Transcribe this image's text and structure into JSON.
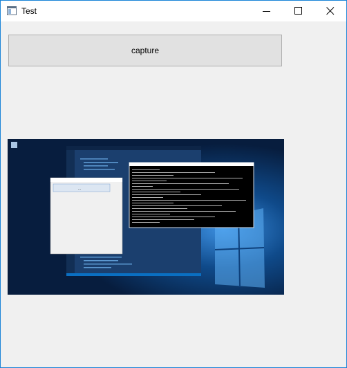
{
  "window": {
    "title": "Test"
  },
  "titlebar": {
    "icons": [
      "app-icon",
      "minimize-icon",
      "maximize-icon",
      "close-icon"
    ]
  },
  "toolbar": {
    "capture_label": "capture"
  },
  "preview": {
    "kind": "desktop-screenshot-thumbnail",
    "mini_window_label": "..."
  },
  "colors": {
    "accent": "#1883d7",
    "button_bg": "#e1e1e1",
    "button_border": "#adadad",
    "window_bg": "#f0f0f0",
    "desktop_bg": "#0a2a5a",
    "console_bg": "#000000"
  }
}
